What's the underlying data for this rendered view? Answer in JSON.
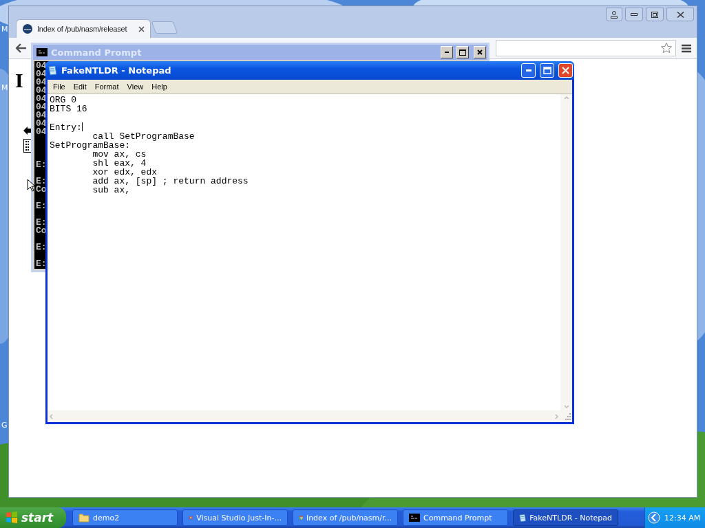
{
  "desktop": {
    "kind": "picture",
    "labels": [
      "M",
      "M",
      "G"
    ]
  },
  "browser": {
    "tabs": [
      {
        "title": "Index of /pub/nasm/releaset",
        "selected": true
      }
    ],
    "page_heading": "I"
  },
  "command_prompt": {
    "title": "Command Prompt",
    "active": false,
    "blocks": [
      [
        "04",
        "04",
        "04",
        "04",
        "04",
        "04",
        "04",
        "04",
        "04"
      ],
      [
        "E:"
      ],
      [
        "E:",
        "Co"
      ],
      [
        "E:"
      ],
      [
        "E:",
        "Co"
      ],
      [
        "E:"
      ],
      [
        "E:"
      ]
    ]
  },
  "notepad": {
    "title": "FakeNTLDR - Notepad",
    "active": true,
    "menu": [
      "File",
      "Edit",
      "Format",
      "View",
      "Help"
    ],
    "text_before_caret": "ORG 0\nBITS 16\n\nEntry:",
    "text_after_caret": "\n        call SetProgramBase\nSetProgramBase:\n        mov ax, cs\n        shl eax, 4\n        xor edx, edx\n        add ax, [sp] ; return address\n        sub ax,"
  },
  "taskbar": {
    "start": "start",
    "buttons": [
      {
        "label": "demo2",
        "kind": "folder",
        "selected": false
      },
      {
        "label": "Visual Studio Just-In-...",
        "kind": "debugger",
        "selected": false
      },
      {
        "label": "Index of /pub/nasm/r...",
        "kind": "browser",
        "selected": false
      },
      {
        "label": "Command Prompt",
        "kind": "console",
        "selected": false
      },
      {
        "label": "FakeNTLDR - Notepad",
        "kind": "notepad",
        "selected": true
      }
    ],
    "clock": "12:34 AM"
  }
}
